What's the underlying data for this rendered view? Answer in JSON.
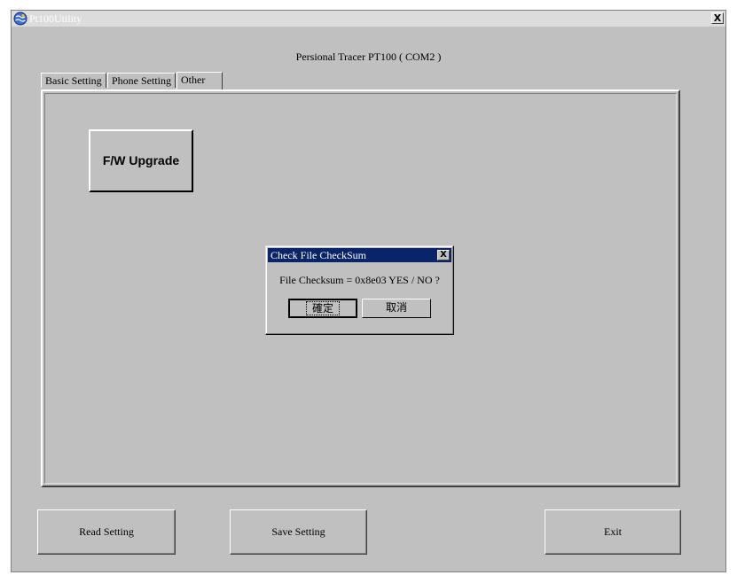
{
  "window": {
    "title": "Pt100Utility",
    "close_glyph": "X",
    "icon": "globe-app-icon"
  },
  "header": {
    "device_label": "Persional Tracer PT100 ( COM2 )"
  },
  "tabs": [
    {
      "label": "Basic Setting",
      "active": false
    },
    {
      "label": "Phone Setting",
      "active": false
    },
    {
      "label": "Other",
      "active": true
    }
  ],
  "panel": {
    "fw_upgrade_label": "F/W Upgrade"
  },
  "dialog": {
    "title": "Check File CheckSum",
    "close_glyph": "X",
    "message": "File Checksum = 0x8e03  YES / NO ?",
    "ok_label": "確定",
    "cancel_label": "取消"
  },
  "buttons": {
    "read_label": "Read Setting",
    "save_label": "Save Setting",
    "exit_label": "Exit"
  },
  "colors": {
    "dialog_title_bg": "#0a246a",
    "face": "#c0c0c0"
  }
}
